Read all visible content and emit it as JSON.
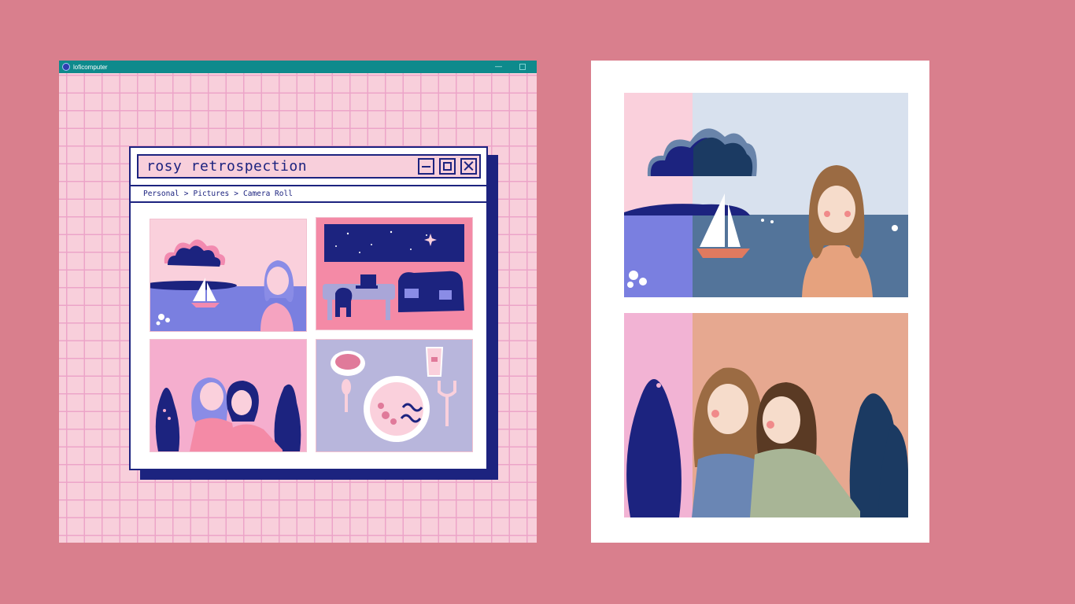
{
  "os_window": {
    "title": "loficomputer",
    "titlebar_color": "#0e8a8c",
    "minimize_glyph": "—"
  },
  "retro_window": {
    "title": "rosy retrospection",
    "accent_color": "#1c237f",
    "breadcrumb": [
      {
        "label": "Personal"
      },
      {
        "label": ">"
      },
      {
        "label": "Pictures"
      },
      {
        "label": ">"
      },
      {
        "label": "Camera Roll"
      }
    ],
    "thumbnails": [
      {
        "icon": "sailboat-lake-woman-image"
      },
      {
        "icon": "night-sky-living-room-image"
      },
      {
        "icon": "friends-hugging-image"
      },
      {
        "icon": "dinner-table-image"
      }
    ]
  },
  "photo_frame": {
    "photos": [
      {
        "icon": "sailboat-lake-woman-photo"
      },
      {
        "icon": "friends-hugging-photo"
      }
    ]
  },
  "colors": {
    "background": "#d97f8d",
    "grid_pink": "#f8cfdb",
    "navy": "#1c237f"
  }
}
